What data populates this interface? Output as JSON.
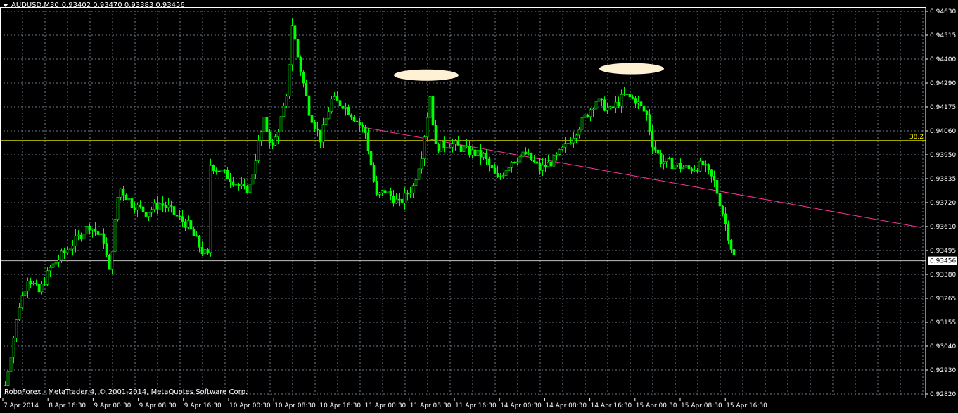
{
  "header": {
    "symbol_label": "AUDUSD,M30",
    "ohlc_label": "0.93402 0.93470 0.93383 0.93456"
  },
  "footer": {
    "copyright": "RoboForex - MetaTrader 4, © 2001-2014, MetaQuotes Software Corp."
  },
  "colors": {
    "background": "#000000",
    "candles": "#00ff00",
    "grid": "#6e7b8b",
    "fib_level": "#ffff00",
    "trendline": "#ff3399",
    "price_line": "#c0c0c0",
    "ellipse": "#fff1d4",
    "axis_text": "#ffffff"
  },
  "chart_data": {
    "type": "candlestick",
    "y_ticks": [
      "0.94630",
      "0.94515",
      "0.94400",
      "0.94290",
      "0.94175",
      "0.94060",
      "0.93950",
      "0.93835",
      "0.93720",
      "0.93610",
      "0.93495",
      "0.93380",
      "0.93265",
      "0.93155",
      "0.93040",
      "0.92930",
      "0.92820"
    ],
    "x_ticks": [
      "7 Apr 2014",
      "8 Apr 16:30",
      "9 Apr 00:30",
      "9 Apr 08:30",
      "9 Apr 16:30",
      "10 Apr 00:30",
      "10 Apr 08:30",
      "10 Apr 16:30",
      "11 Apr 00:30",
      "11 Apr 08:30",
      "11 Apr 16:30",
      "14 Apr 00:30",
      "14 Apr 08:30",
      "14 Apr 16:30",
      "15 Apr 00:30",
      "15 Apr 08:30",
      "15 Apr 16:30"
    ],
    "ylim": [
      0.9282,
      0.9463
    ],
    "bar_count": 260,
    "current_price": "0.93456",
    "fib_level": {
      "label": "38.2",
      "price": 0.94012
    },
    "trendline": {
      "from_bar": 127,
      "from_price": 0.94075,
      "to_bar": 326,
      "to_price": 0.9361
    },
    "ellipses": [
      {
        "bar": 150,
        "price": 0.94315
      },
      {
        "bar": 223,
        "price": 0.94345
      }
    ],
    "anchors": [
      [
        0,
        0.9288
      ],
      [
        5,
        0.9325
      ],
      [
        8,
        0.9338
      ],
      [
        12,
        0.9331
      ],
      [
        16,
        0.9342
      ],
      [
        20,
        0.9348
      ],
      [
        25,
        0.9355
      ],
      [
        30,
        0.9362
      ],
      [
        35,
        0.9355
      ],
      [
        37,
        0.934
      ],
      [
        40,
        0.9375
      ],
      [
        41,
        0.9379
      ],
      [
        45,
        0.9372
      ],
      [
        50,
        0.9368
      ],
      [
        55,
        0.9372
      ],
      [
        58,
        0.937
      ],
      [
        60,
        0.9367
      ],
      [
        65,
        0.9362
      ],
      [
        70,
        0.935
      ],
      [
        72,
        0.9348
      ],
      [
        73,
        0.939
      ],
      [
        80,
        0.9384
      ],
      [
        85,
        0.9378
      ],
      [
        87,
        0.938
      ],
      [
        90,
        0.94
      ],
      [
        92,
        0.941
      ],
      [
        95,
        0.9398
      ],
      [
        100,
        0.942
      ],
      [
        102,
        0.9455
      ],
      [
        104,
        0.944
      ],
      [
        108,
        0.9415
      ],
      [
        112,
        0.9402
      ],
      [
        116,
        0.942
      ],
      [
        120,
        0.9418
      ],
      [
        124,
        0.9412
      ],
      [
        128,
        0.9405
      ],
      [
        132,
        0.9375
      ],
      [
        135,
        0.9378
      ],
      [
        140,
        0.9372
      ],
      [
        145,
        0.938
      ],
      [
        148,
        0.9395
      ],
      [
        151,
        0.9422
      ],
      [
        153,
        0.9398
      ],
      [
        158,
        0.94
      ],
      [
        165,
        0.9396
      ],
      [
        170,
        0.9394
      ],
      [
        175,
        0.9383
      ],
      [
        180,
        0.9392
      ],
      [
        185,
        0.9395
      ],
      [
        190,
        0.9388
      ],
      [
        195,
        0.9392
      ],
      [
        200,
        0.94
      ],
      [
        205,
        0.941
      ],
      [
        210,
        0.942
      ],
      [
        215,
        0.9415
      ],
      [
        220,
        0.9422
      ],
      [
        224,
        0.942
      ],
      [
        228,
        0.9413
      ],
      [
        230,
        0.94
      ],
      [
        233,
        0.9392
      ],
      [
        238,
        0.939
      ],
      [
        243,
        0.9388
      ],
      [
        248,
        0.939
      ],
      [
        252,
        0.9382
      ],
      [
        255,
        0.9368
      ],
      [
        258,
        0.9352
      ],
      [
        260,
        0.9343
      ]
    ]
  }
}
